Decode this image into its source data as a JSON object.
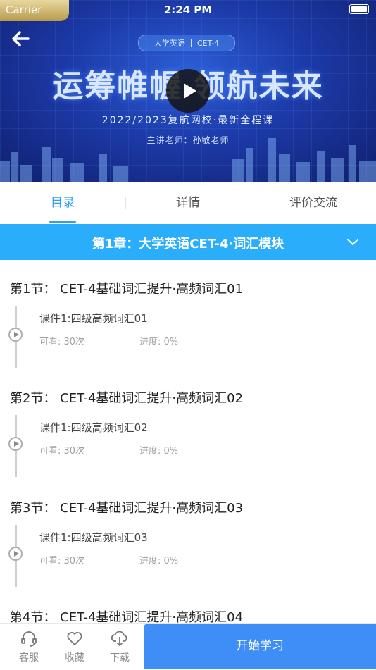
{
  "status_bar": {
    "carrier": "Carrier",
    "time": "2:24 PM"
  },
  "hero": {
    "tag_left": "大学英语",
    "tag_right": "CET-4",
    "slogan": "运筹帷幄 领航未来",
    "subtitle": "2022/2023复航网校·最新全程课",
    "teacher": "主讲老师：孙敏老师"
  },
  "tabs": [
    {
      "label": "目录",
      "active": true
    },
    {
      "label": "详情",
      "active": false
    },
    {
      "label": "评价交流",
      "active": false
    }
  ],
  "chapter": {
    "title": "第1章：大学英语CET-4·词汇模块"
  },
  "sections": [
    {
      "title": "第1节： CET-4基础词汇提升·高频词汇01",
      "lesson": "课件1:四级高频词汇01",
      "views": "可看: 30次",
      "progress": "进度: 0%"
    },
    {
      "title": "第2节： CET-4基础词汇提升·高频词汇02",
      "lesson": "课件1:四级高频词汇02",
      "views": "可看: 30次",
      "progress": "进度: 0%"
    },
    {
      "title": "第3节： CET-4基础词汇提升·高频词汇03",
      "lesson": "课件1:四级高频词汇03",
      "views": "可看: 30次",
      "progress": "进度: 0%"
    },
    {
      "title": "第4节： CET-4基础词汇提升·高频词汇04"
    }
  ],
  "bottom_bar": {
    "service": "客服",
    "favorite": "收藏",
    "download": "下载",
    "start": "开始学习"
  },
  "colors": {
    "accent": "#2ea0f0",
    "chapter_bg": "#2aaefc",
    "button": "#3f8ef7"
  }
}
